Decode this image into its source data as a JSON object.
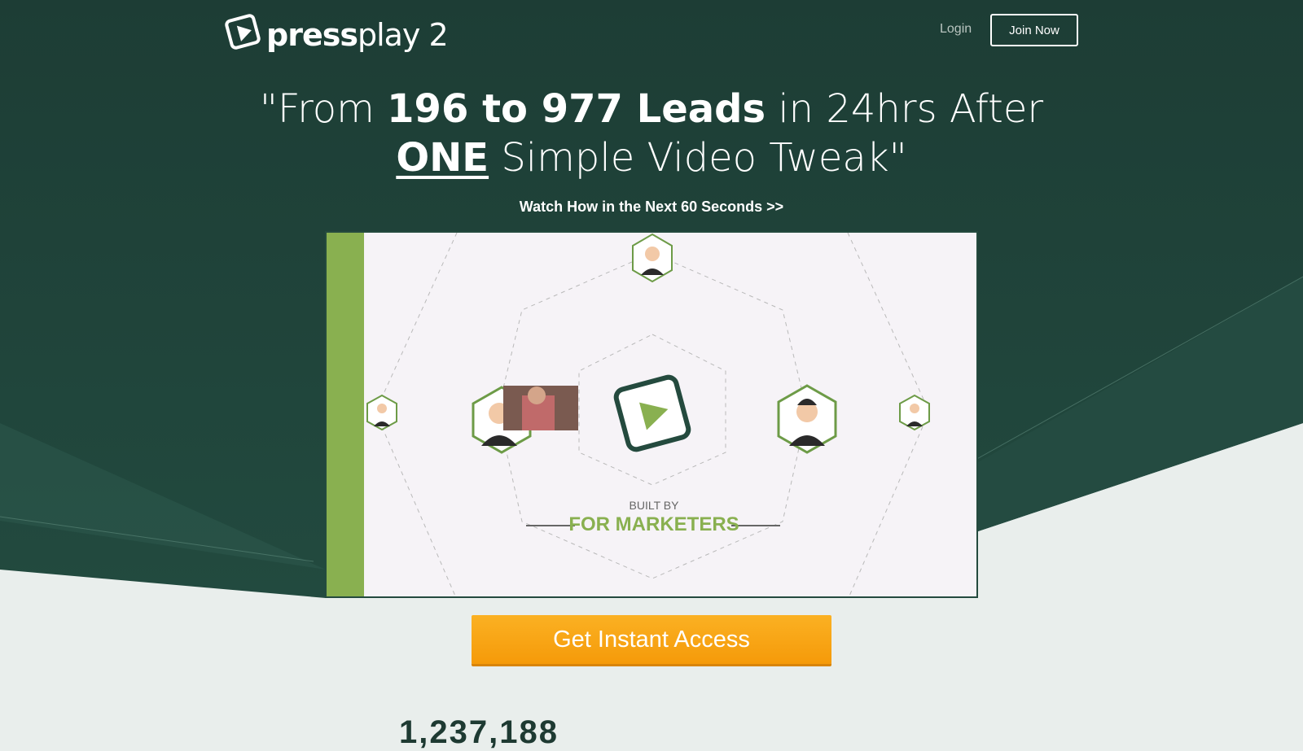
{
  "brand": {
    "name_bold": "press",
    "name_light": "play 2"
  },
  "nav": {
    "login_label": "Login",
    "join_label": "Join Now"
  },
  "hero": {
    "headline_open": "\"From ",
    "headline_bold": "196 to 977 Leads",
    "headline_mid": " in 24hrs After",
    "headline_underline": "ONE",
    "headline_end": " Simple Video Tweak\"",
    "subheadline": "Watch How in the Next 60 Seconds >>"
  },
  "video": {
    "built_by": "BUILT BY",
    "for_marketers": "FOR MARKETERS"
  },
  "cta": {
    "label": "Get Instant Access"
  },
  "counter": {
    "value": "1,237,188"
  },
  "colors": {
    "dark_green": "#1f4038",
    "accent_green": "#89b050",
    "orange": "#f7a416"
  }
}
